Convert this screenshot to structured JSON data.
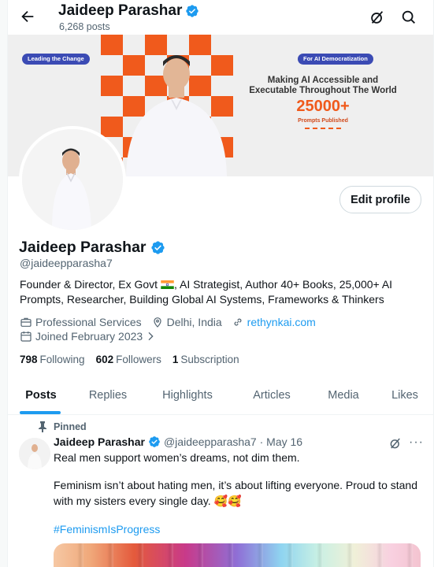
{
  "header": {
    "name": "Jaideep Parashar",
    "posts_count": "6,268 posts",
    "icons": [
      "back-arrow-icon",
      "grok-icon",
      "search-icon"
    ]
  },
  "banner": {
    "left_pill": "Leading the Change",
    "right_pill": "For AI Democratization",
    "headline": "Making AI Accessible and Executable Throughout The World",
    "stat_value": "25000+",
    "stat_label": "Prompts Published",
    "colors": {
      "orange": "#f05a1c",
      "pill": "#3b4bb4"
    }
  },
  "profile": {
    "edit_button": "Edit profile",
    "name": "Jaideep Parashar",
    "handle": "@jaideepparasha7",
    "bio_part1": "Founder & Director, Ex Govt ",
    "bio_part2": ", AI Strategist, Author 40+ Books, 25,000+ AI Prompts, Researcher, Building Global AI Systems, Frameworks & Thinkers",
    "category": "Professional Services",
    "location": "Delhi, India",
    "website": "rethynkai.com",
    "joined": "Joined February 2023",
    "following_count": "798",
    "following_label": "Following",
    "followers_count": "602",
    "followers_label": "Followers",
    "subscription_count": "1",
    "subscription_label": "Subscription"
  },
  "tabs": [
    "Posts",
    "Replies",
    "Highlights",
    "Articles",
    "Media",
    "Likes"
  ],
  "pinned_post": {
    "pinned_label": "Pinned",
    "author": "Jaideep Parashar",
    "handle_date": "@jaideepparasha7 · May 16",
    "line1": "Real men support women’s dreams, not dim them.",
    "line2": "Feminism isn’t about hating men, it’s about lifting everyone. Proud to stand with my sisters every single day. 🥰🥰",
    "hashtag": "#FeminismIsProgress"
  },
  "colors": {
    "accent": "#1d9bf0",
    "text": "#0f1419",
    "muted": "#536471",
    "verified": "#1d9bf0"
  }
}
